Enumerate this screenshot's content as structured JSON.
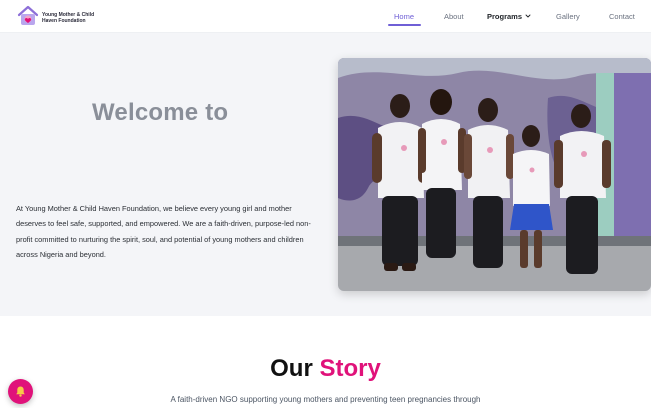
{
  "brand": {
    "name_line1": "Young Mother & Child",
    "name_line2": "Haven Foundation",
    "logo_icon": "home-heart-logo-icon"
  },
  "nav": {
    "items": [
      {
        "label": "Home",
        "active": true
      },
      {
        "label": "About"
      },
      {
        "label": "Programs",
        "has_dropdown": true
      },
      {
        "label": "Gallery"
      },
      {
        "label": "Contact"
      }
    ]
  },
  "hero": {
    "title": "Welcome to",
    "description": "At Young Mother & Child Haven Foundation, we believe every young girl and mother deserves to feel safe, supported, and empowered. We are a faith-driven, purpose-led non-profit committed to nurturing the spirit, soul, and potential of young mothers and children across Nigeria and beyond.",
    "photo_icon": "group-photo"
  },
  "story": {
    "title_part1": "Our",
    "title_part2": "Story",
    "subtitle": "A faith-driven NGO supporting young mothers and preventing teen pregnancies through"
  },
  "floating_button": {
    "icon": "bell-icon"
  },
  "colors": {
    "accent_purple": "#6f5fd6",
    "accent_pink": "#e0127a",
    "hero_bg": "#f4f5f8",
    "title_gray": "#8a8f99"
  }
}
